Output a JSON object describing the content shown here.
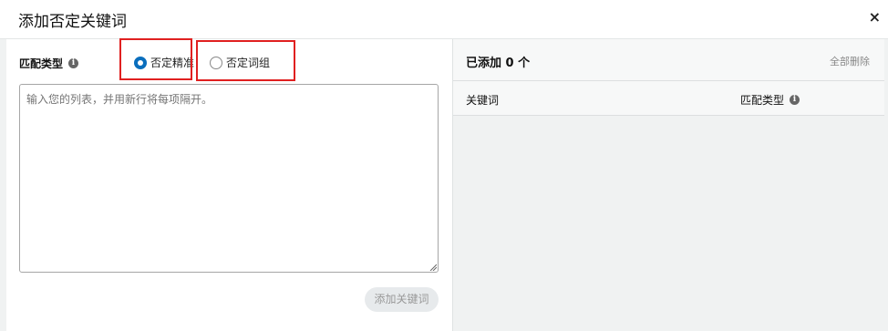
{
  "dialog": {
    "title": "添加否定关键词",
    "close_glyph": "×"
  },
  "left": {
    "match_type_label": "匹配类型",
    "info_glyph": "i",
    "options": [
      {
        "label": "否定精准",
        "checked": true
      },
      {
        "label": "否定词组",
        "checked": false
      }
    ],
    "textarea_placeholder": "输入您的列表，并用新行将每项隔开。",
    "add_button_label": "添加关键词"
  },
  "right": {
    "added_label": "已添加 0 个",
    "remove_all_label": "全部删除",
    "columns": [
      "关键词",
      "匹配类型"
    ]
  },
  "colors": {
    "accent": "#0a6ebd",
    "highlight_box": "#e02020",
    "panel_bg": "#f0f2f2"
  }
}
